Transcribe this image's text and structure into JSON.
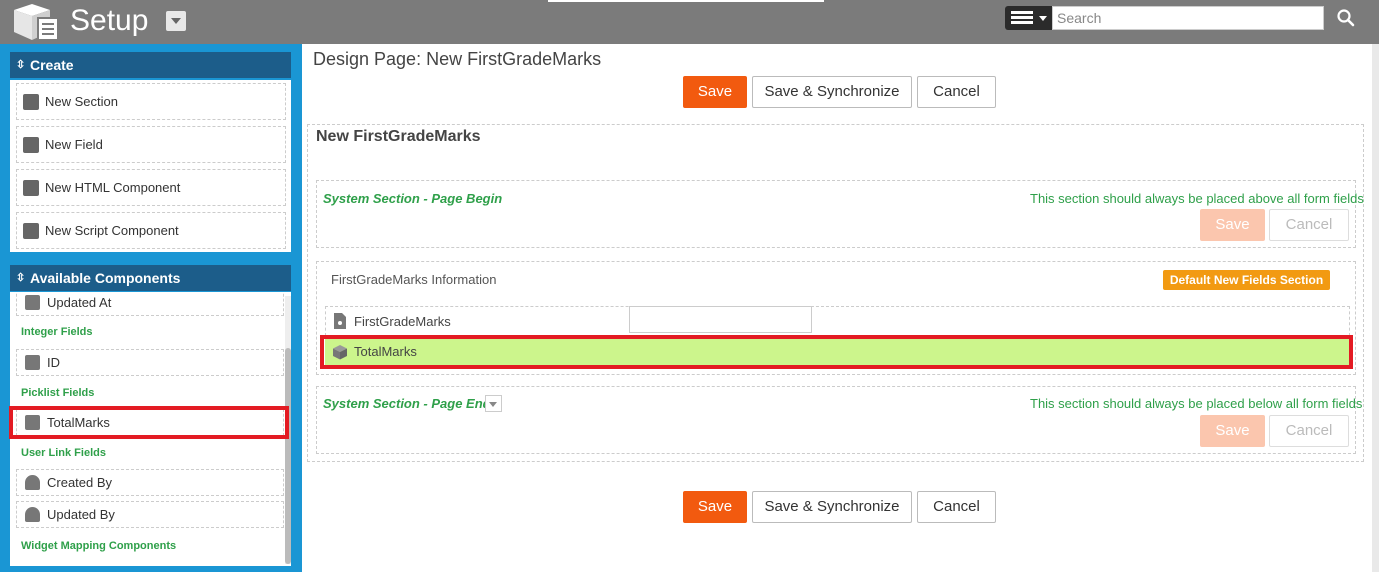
{
  "header": {
    "title": "Setup",
    "search_placeholder": "Search",
    "logo_icon": "cube-stack-logo",
    "menu_icon": "hamburger-menu-icon",
    "search_icon": "search-icon"
  },
  "sidebar": {
    "create": {
      "heading": "Create",
      "items": [
        {
          "label": "New Section",
          "icon": "section-layout-icon"
        },
        {
          "label": "New Field",
          "icon": "field-list-icon"
        },
        {
          "label": "New HTML Component",
          "icon": "code-icon"
        },
        {
          "label": "New Script Component",
          "icon": "script-icon"
        }
      ]
    },
    "available": {
      "heading": "Available Components",
      "updated_at": "Updated At",
      "integer_group": "Integer Fields",
      "id_item": "ID",
      "picklist_group": "Picklist Fields",
      "totalmarks_item": "TotalMarks",
      "userlink_group": "User Link Fields",
      "created_by": "Created By",
      "updated_by": "Updated By",
      "widget_group": "Widget Mapping Components"
    }
  },
  "main": {
    "page_title": "Design Page: New FirstGradeMarks",
    "save": "Save",
    "save_sync": "Save & Synchronize",
    "cancel": "Cancel",
    "form_title": "New FirstGradeMarks",
    "begin_section": {
      "label": "System Section - Page Begin",
      "note": "This section should always be placed above all form fields"
    },
    "info_section": {
      "label": "FirstGradeMarks Information",
      "badge": "Default New Fields Section",
      "fields": [
        "FirstGradeMarks",
        "TotalMarks"
      ]
    },
    "end_section": {
      "label": "System Section - Page End",
      "note": "This section should always be placed below all form fields"
    }
  },
  "colors": {
    "accent": "#f25a0f",
    "sidebar_bg": "#1a96d4",
    "panel_header": "#1c5d8a",
    "green_text": "#2fa04a",
    "highlight_row": "#ccf58c",
    "badge": "#f29a12",
    "annotation_red": "#e31b23"
  }
}
